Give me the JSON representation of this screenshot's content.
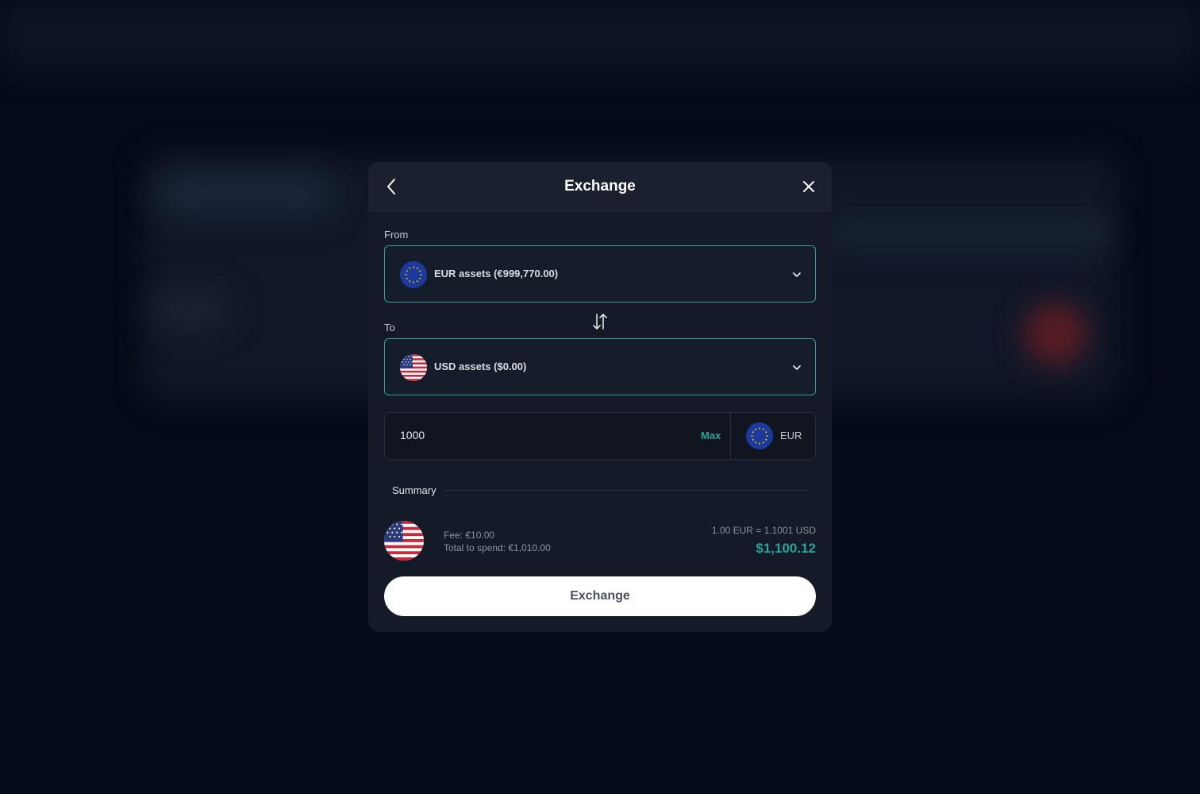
{
  "modal": {
    "title": "Exchange",
    "back_icon": "chevron-left-icon",
    "close_icon": "close-icon"
  },
  "from": {
    "label": "From",
    "flag_icon": "eu-flag-icon",
    "value": "EUR assets (€999,770.00)"
  },
  "to": {
    "label": "To",
    "flag_icon": "us-flag-icon",
    "value": "USD assets ($0.00)"
  },
  "swap_icon": "swap-arrows-icon",
  "amount": {
    "value": "1000",
    "max_label": "Max",
    "currency": "EUR",
    "currency_flag_icon": "eu-flag-icon"
  },
  "summary": {
    "label": "Summary",
    "fee": "Fee: €10.00",
    "total": "Total to spend: €1,010.00",
    "rate": "1.00 EUR = 1.1001 USD",
    "result": "$1,100.12",
    "flag_icon": "us-flag-icon"
  },
  "submit": {
    "label": "Exchange"
  },
  "colors": {
    "accent": "#2ba39c",
    "background": "#050b18",
    "modal": "#141a27"
  }
}
